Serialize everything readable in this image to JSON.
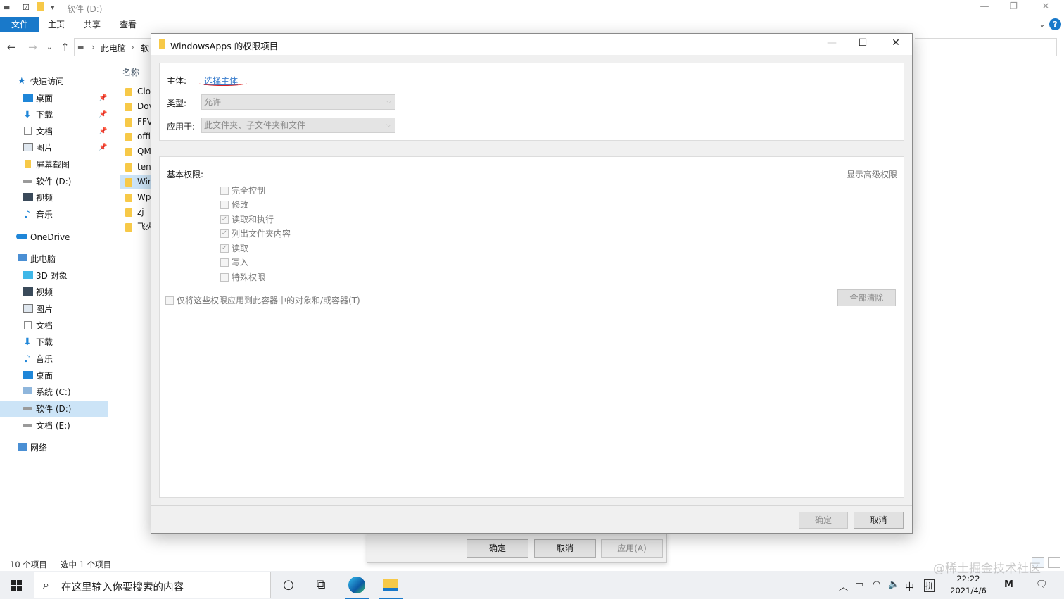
{
  "explorer": {
    "title": "软件 (D:)",
    "ribbon_tabs": [
      "文件",
      "主页",
      "共享",
      "查看"
    ],
    "help": "?",
    "breadcrumb": [
      "此电脑",
      "软"
    ],
    "column_header": "名称",
    "files": [
      "Clo",
      "Dov",
      "FFV",
      "offi",
      "QM",
      "ten",
      "Wir",
      "Wp",
      "zj",
      "飞火"
    ],
    "status_items": "10 个项目",
    "status_selected": "选中 1 个项目"
  },
  "sidebar": {
    "quick_access": "快速访问",
    "quick_items": [
      "桌面",
      "下载",
      "文档",
      "图片",
      "屏幕截图",
      "软件 (D:)",
      "视频",
      "音乐"
    ],
    "onedrive": "OneDrive",
    "this_pc": "此电脑",
    "pc_items": [
      "3D 对象",
      "视频",
      "图片",
      "文档",
      "下载",
      "音乐",
      "桌面",
      "系统 (C:)",
      "软件 (D:)",
      "文档 (E:)"
    ],
    "network": "网络"
  },
  "properties_window": {
    "ok": "确定",
    "cancel": "取消",
    "apply": "应用(A)"
  },
  "dialog": {
    "title": "WindowsApps 的权限项目",
    "principal_label": "主体:",
    "principal_link": "选择主体",
    "type_label": "类型:",
    "type_value": "允许",
    "applies_label": "应用于:",
    "applies_value": "此文件夹、子文件夹和文件",
    "basic_perms_label": "基本权限:",
    "show_advanced": "显示高级权限",
    "permissions": [
      {
        "label": "完全控制",
        "checked": false
      },
      {
        "label": "修改",
        "checked": false
      },
      {
        "label": "读取和执行",
        "checked": true
      },
      {
        "label": "列出文件夹内容",
        "checked": true
      },
      {
        "label": "读取",
        "checked": true
      },
      {
        "label": "写入",
        "checked": false
      },
      {
        "label": "特殊权限",
        "checked": false
      }
    ],
    "apply_only_container": "仅将这些权限应用到此容器中的对象和/或容器(T)",
    "clear_all": "全部清除",
    "ok": "确定",
    "cancel": "取消"
  },
  "taskbar": {
    "search_placeholder": "在这里输入你要搜索的内容",
    "ime_lang": "中",
    "ime_mode": "拼",
    "time": "22:22",
    "date": "2021/4/6"
  },
  "watermark": "@稀土掘金技术社区",
  "colors": {
    "accent": "#1979ca",
    "link": "#3c7fce",
    "annotation_red": "#dd2222",
    "folder": "#f7c948"
  }
}
